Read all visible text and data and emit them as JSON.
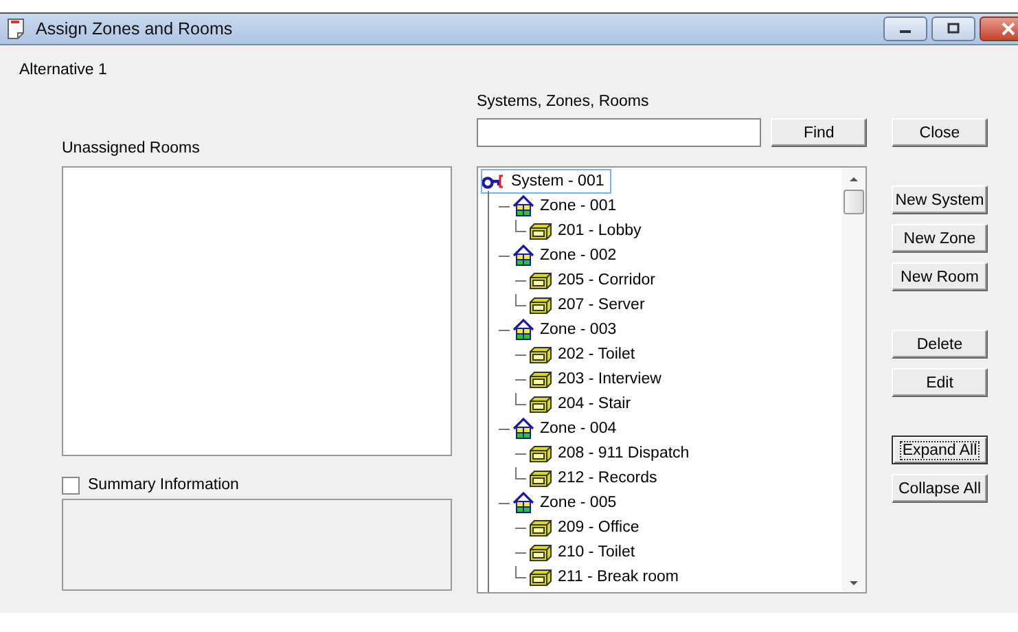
{
  "window": {
    "title": "Assign Zones and Rooms"
  },
  "alternative": "Alternative 1",
  "unassigned": {
    "label": "Unassigned Rooms"
  },
  "summary": {
    "label": "Summary Information",
    "checked": false
  },
  "tree_panel": {
    "label": "Systems, Zones, Rooms",
    "find_button": {
      "label": "Find"
    },
    "tree": [
      {
        "label": "System - 001",
        "kind": "system",
        "selected": true,
        "children": [
          {
            "label": "Zone - 001",
            "kind": "zone",
            "selected": false,
            "children": [
              {
                "label": "201 - Lobby",
                "kind": "room",
                "selected": false
              }
            ]
          },
          {
            "label": "Zone - 002",
            "kind": "zone",
            "selected": false,
            "children": [
              {
                "label": "205 - Corridor",
                "kind": "room",
                "selected": false
              },
              {
                "label": "207 - Server",
                "kind": "room",
                "selected": false
              }
            ]
          },
          {
            "label": "Zone - 003",
            "kind": "zone",
            "selected": false,
            "children": [
              {
                "label": "202 - Toilet",
                "kind": "room",
                "selected": false
              },
              {
                "label": "203 - Interview",
                "kind": "room",
                "selected": false
              },
              {
                "label": "204 - Stair",
                "kind": "room",
                "selected": false
              }
            ]
          },
          {
            "label": "Zone - 004",
            "kind": "zone",
            "selected": false,
            "children": [
              {
                "label": "208 - 911 Dispatch",
                "kind": "room",
                "selected": false
              },
              {
                "label": "212 - Records",
                "kind": "room",
                "selected": false
              }
            ]
          },
          {
            "label": "Zone - 005",
            "kind": "zone",
            "selected": false,
            "children": [
              {
                "label": "209 - Office",
                "kind": "room",
                "selected": false
              },
              {
                "label": "210 - Toilet",
                "kind": "room",
                "selected": false
              },
              {
                "label": "211 - Break room",
                "kind": "room",
                "selected": false
              }
            ]
          }
        ]
      }
    ]
  },
  "buttons": [
    {
      "label": "Close",
      "focused": false
    },
    {
      "label": "New System",
      "focused": false
    },
    {
      "label": "New Zone",
      "focused": false
    },
    {
      "label": "New Room",
      "focused": false
    },
    {
      "label": "Delete",
      "focused": false
    },
    {
      "label": "Edit",
      "focused": false
    },
    {
      "label": "Expand All",
      "focused": true
    },
    {
      "label": "Collapse All",
      "focused": false
    }
  ]
}
